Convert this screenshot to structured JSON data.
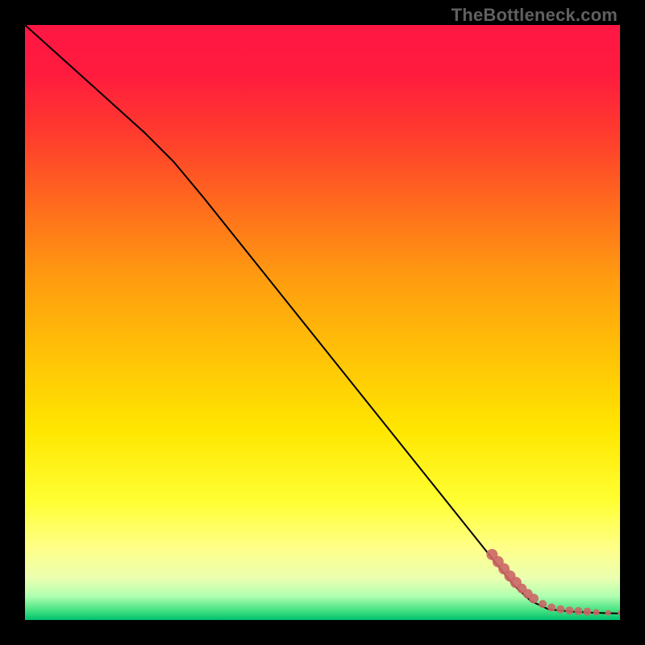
{
  "watermark": "TheBottleneck.com",
  "chart_data": {
    "type": "line",
    "title": "",
    "xlabel": "",
    "ylabel": "",
    "xlim": [
      0,
      100
    ],
    "ylim": [
      0,
      100
    ],
    "grid": false,
    "legend": false,
    "gradient_stops": [
      {
        "offset": 0.0,
        "color": "#ff1744"
      },
      {
        "offset": 0.08,
        "color": "#ff1b3e"
      },
      {
        "offset": 0.18,
        "color": "#ff3a2e"
      },
      {
        "offset": 0.3,
        "color": "#ff6a1e"
      },
      {
        "offset": 0.42,
        "color": "#ff9a10"
      },
      {
        "offset": 0.55,
        "color": "#ffc107"
      },
      {
        "offset": 0.68,
        "color": "#ffe600"
      },
      {
        "offset": 0.8,
        "color": "#ffff33"
      },
      {
        "offset": 0.88,
        "color": "#ffff8a"
      },
      {
        "offset": 0.93,
        "color": "#eaffb0"
      },
      {
        "offset": 0.96,
        "color": "#b0ffb0"
      },
      {
        "offset": 0.985,
        "color": "#40e080"
      },
      {
        "offset": 1.0,
        "color": "#00c070"
      }
    ],
    "series": [
      {
        "name": "main-curve",
        "type": "line",
        "color": "#000000",
        "x": [
          0,
          10,
          20,
          25,
          30,
          40,
          50,
          60,
          70,
          78,
          82,
          85,
          88,
          92,
          96,
          100
        ],
        "y": [
          100,
          91,
          82,
          77,
          71,
          58.5,
          46,
          33.5,
          21,
          11,
          6,
          3.2,
          1.8,
          1.4,
          1.2,
          1.1
        ]
      },
      {
        "name": "tail-points",
        "type": "scatter",
        "color": "#cc6666",
        "x": [
          78.5,
          79.5,
          80.5,
          81.5,
          82.5,
          83.5,
          84.5,
          85.5,
          87,
          88.5,
          90,
          91.5,
          93,
          94.5,
          96,
          98,
          100
        ],
        "y": [
          11.0,
          9.8,
          8.6,
          7.4,
          6.3,
          5.3,
          4.4,
          3.6,
          2.7,
          2.1,
          1.8,
          1.6,
          1.5,
          1.4,
          1.3,
          1.2,
          1.2
        ],
        "sizes": [
          7,
          7,
          7,
          7,
          7,
          6,
          6,
          6,
          5,
          5,
          5,
          5,
          5,
          5,
          4,
          3.5,
          3
        ]
      }
    ]
  }
}
